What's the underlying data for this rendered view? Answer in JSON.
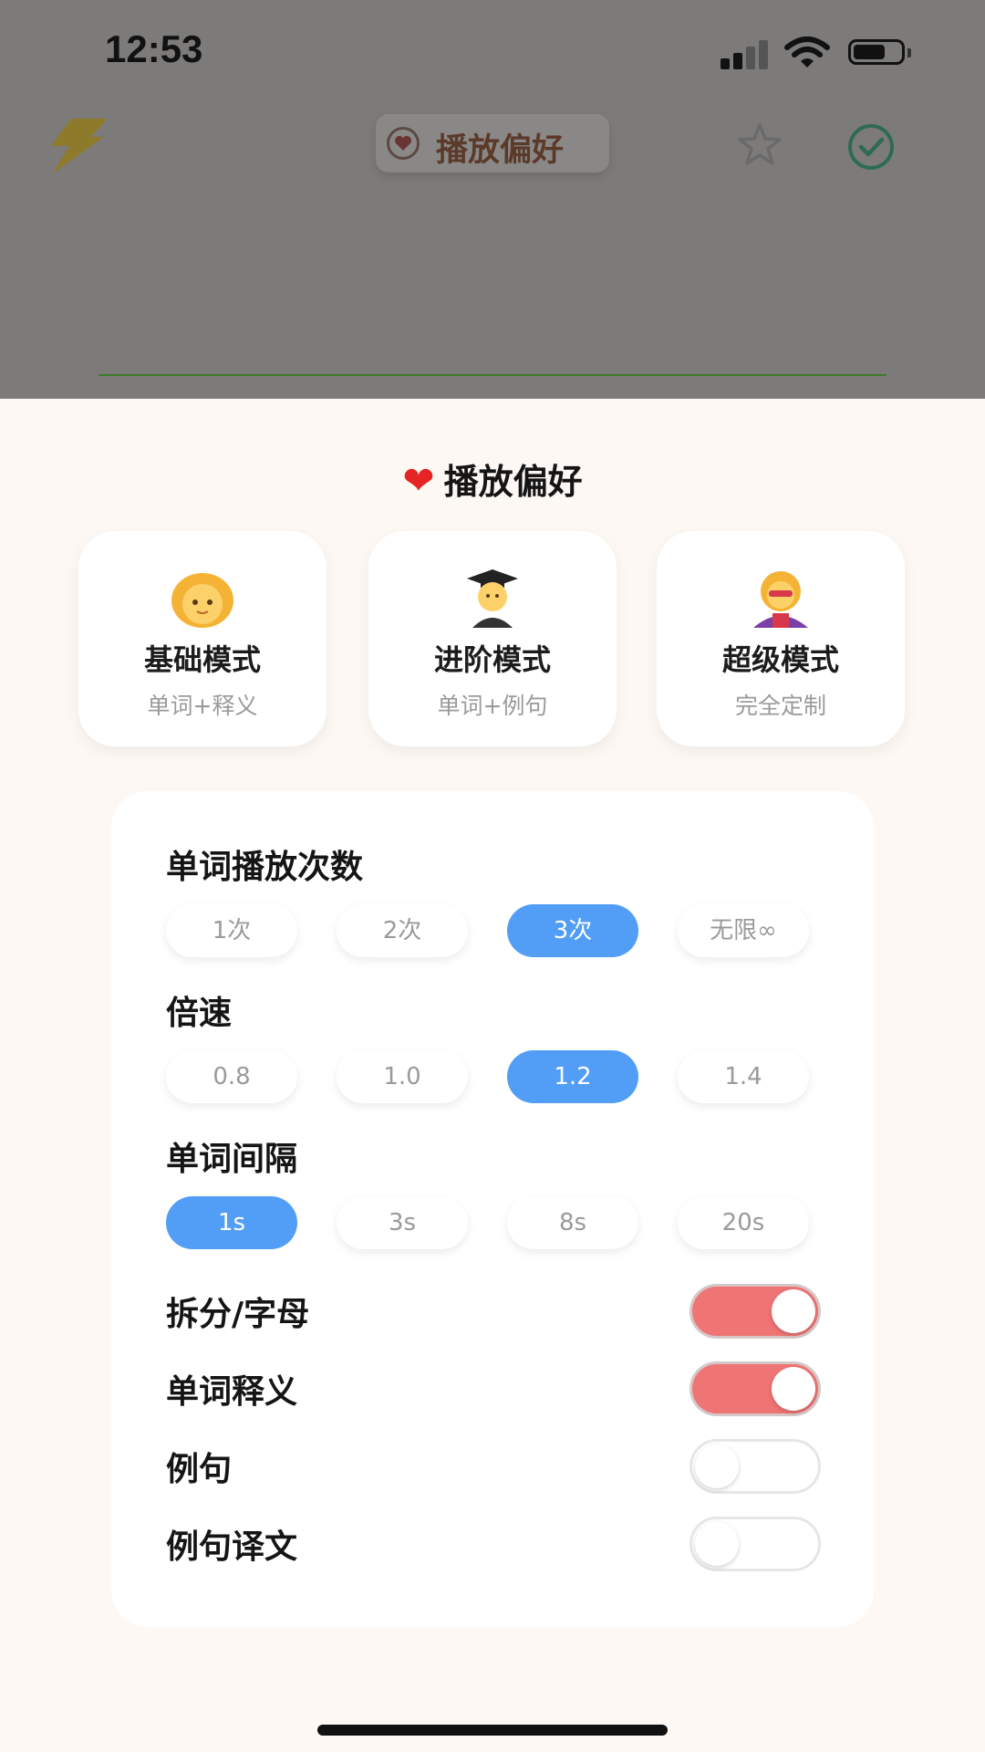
{
  "status_bar": {
    "time": "12:53"
  },
  "header": {
    "title": "播放偏好"
  },
  "sheet": {
    "title": "播放偏好"
  },
  "modes": [
    {
      "name": "基础模式",
      "desc": "单词+释义"
    },
    {
      "name": "进阶模式",
      "desc": "单词+例句"
    },
    {
      "name": "超级模式",
      "desc": "完全定制"
    }
  ],
  "settings": {
    "play_count": {
      "label": "单词播放次数",
      "options": [
        "1次",
        "2次",
        "3次",
        "无限∞"
      ],
      "selected": "3次"
    },
    "speed": {
      "label": "倍速",
      "options": [
        "0.8",
        "1.0",
        "1.2",
        "1.4"
      ],
      "selected": "1.2"
    },
    "interval": {
      "label": "单词间隔",
      "options": [
        "1s",
        "3s",
        "8s",
        "20s"
      ],
      "selected": "1s"
    }
  },
  "toggles": [
    {
      "label": "拆分/字母",
      "on": true
    },
    {
      "label": "单词释义",
      "on": true
    },
    {
      "label": "例句",
      "on": false
    },
    {
      "label": "例句译文",
      "on": false
    }
  ],
  "colors": {
    "accent_blue": "#529ef7",
    "toggle_on": "#ef7474",
    "sheet_bg": "#fdf8f3"
  }
}
